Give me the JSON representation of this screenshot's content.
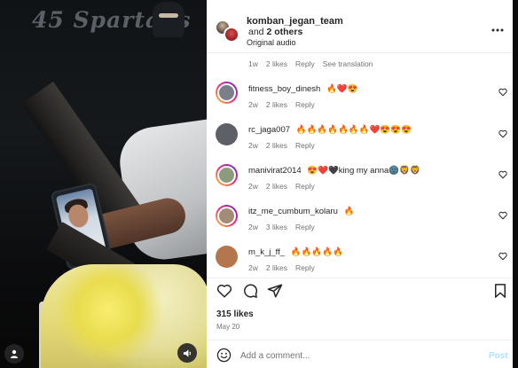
{
  "media": {
    "watermark": "45 Spartans"
  },
  "header": {
    "username": "komban_jegan_team",
    "and_text": "and",
    "others": "2 others",
    "audio": "Original audio"
  },
  "top_meta": {
    "time": "1w",
    "likes": "2 likes",
    "reply": "Reply",
    "translate": "See translation"
  },
  "comments": [
    {
      "username": "fitness_boy_dinesh",
      "text": "🔥❤️😍",
      "time": "2w",
      "likes": "2 likes",
      "reply": "Reply",
      "avatar_color": "#7a7f8a",
      "ring": true
    },
    {
      "username": "rc_jaga007",
      "text": "🔥🔥🔥🔥🔥🔥🔥❤️😍😍😍",
      "time": "2w",
      "likes": "2 likes",
      "reply": "Reply",
      "avatar_color": "#5d6166",
      "ring": false
    },
    {
      "username": "manivirat2014",
      "text": "😍❤️🖤king my anna🌚🦁🦁",
      "time": "2w",
      "likes": "2 likes",
      "reply": "Reply",
      "avatar_color": "#8c9a7e",
      "ring": true
    },
    {
      "username": "itz_me_cumbum_kolaru",
      "text": "🔥",
      "time": "2w",
      "likes": "3 likes",
      "reply": "Reply",
      "avatar_color": "#a38b78",
      "ring": true
    },
    {
      "username": "m_k_j_ff_",
      "text": "🔥🔥🔥🔥🔥",
      "time": "2w",
      "likes": "2 likes",
      "reply": "Reply",
      "avatar_color": "#b3764d",
      "ring": false
    }
  ],
  "footer": {
    "likes": "315 likes",
    "date": "May 20",
    "placeholder": "Add a comment...",
    "post": "Post"
  },
  "colors": {
    "post_disabled": "#b2dffc",
    "meta_gray": "#737373"
  }
}
